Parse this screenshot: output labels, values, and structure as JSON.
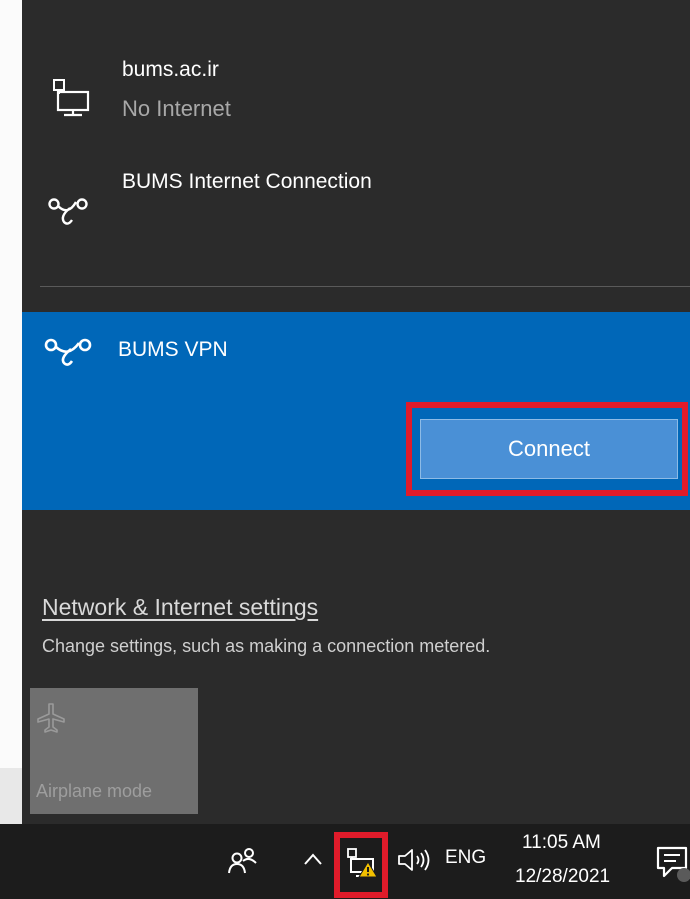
{
  "networks": [
    {
      "name": "bums.ac.ir",
      "status": "No Internet",
      "icon": "ethernet-monitor-icon"
    },
    {
      "name": "BUMS Internet Connection",
      "icon": "vpn-link-icon"
    }
  ],
  "vpn": {
    "name": "BUMS VPN",
    "connect_label": "Connect",
    "icon": "vpn-link-icon"
  },
  "settings": {
    "link_label": "Network & Internet settings",
    "description": "Change settings, such as making a connection metered."
  },
  "quick_actions": [
    {
      "label": "Airplane mode",
      "icon": "airplane-icon"
    }
  ],
  "taskbar": {
    "language": "ENG",
    "time": "11:05 AM",
    "date": "12/28/2021",
    "icons": [
      "people-icon",
      "chevron-up-icon",
      "network-warning-icon",
      "volume-icon",
      "notification-icon"
    ]
  },
  "colors": {
    "flyout_bg": "#2b2b2b",
    "accent": "#0067b8",
    "highlight": "#e01b2a",
    "warning": "#f2c000",
    "taskbar_bg": "#1c1c1c"
  }
}
